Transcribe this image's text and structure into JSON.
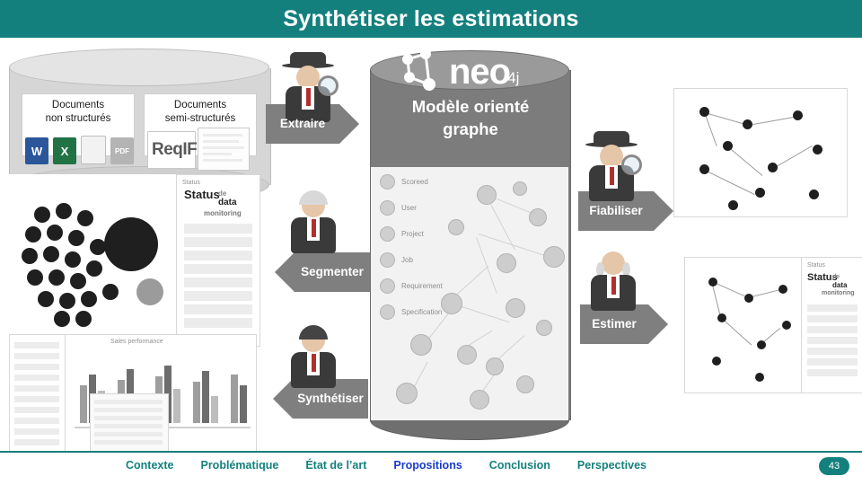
{
  "header": {
    "title": "Synthétiser les estimations"
  },
  "diagram": {
    "documents_unstructured": {
      "line1": "Documents",
      "line2": "non structurés"
    },
    "documents_semistructured": {
      "line1": "Documents",
      "line2": "semi-structurés"
    },
    "graph_model": {
      "line1": "Modèle orienté",
      "line2": "graphe"
    },
    "brand": {
      "name": "neo",
      "suffix": "4j"
    },
    "arrows": {
      "extraire": "Extraire",
      "fiabiliser": "Fiabiliser",
      "segmenter": "Segmenter",
      "estimer": "Estimer",
      "synthetiser": "Synthétiser"
    },
    "file_icons": {
      "word": "W",
      "excel": "X",
      "pdf": "PDF",
      "reqif": "ReqIF"
    },
    "neo4j_legend": [
      "Scoreed",
      "User",
      "Project",
      "Job",
      "Requirement",
      "Specification"
    ],
    "dashboard_label": {
      "status": "Status",
      "of": "de",
      "data": "data",
      "monitoring": "monitoring"
    }
  },
  "footer": {
    "nav": [
      {
        "label": "Contexte",
        "active": false
      },
      {
        "label": "Problématique",
        "active": false
      },
      {
        "label": "État de l’art",
        "active": false
      },
      {
        "label": "Propositions",
        "active": true
      },
      {
        "label": "Conclusion",
        "active": false
      },
      {
        "label": "Perspectives",
        "active": false
      }
    ],
    "slide_number": "43"
  },
  "colors": {
    "brand_teal": "#14807e",
    "active_nav": "#1a3cc8",
    "arrow_gray": "#7f7f7f"
  }
}
